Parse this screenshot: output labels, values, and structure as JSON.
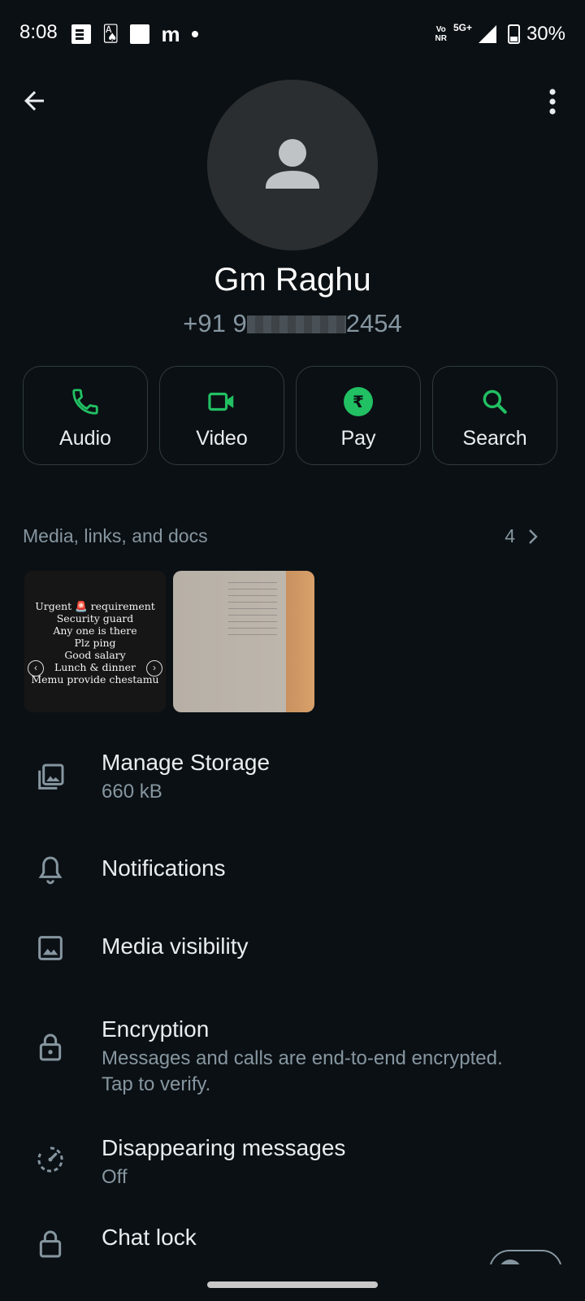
{
  "status_bar": {
    "time": "8:08",
    "network": "5G+",
    "volte_line1": "Vo",
    "volte_line2": "NR",
    "battery": "30%",
    "app_icons": [
      "news-icon",
      "cards-icon",
      "square-icon",
      "m-app-icon",
      "dot-icon"
    ]
  },
  "header": {
    "back_icon": "arrow-left-icon",
    "menu_icon": "more-vert-icon"
  },
  "contact": {
    "name": "Gm Raghu",
    "phone_prefix": "+91 9",
    "phone_suffix": "2454"
  },
  "actions": [
    {
      "label": "Audio",
      "icon": "phone-icon"
    },
    {
      "label": "Video",
      "icon": "video-icon"
    },
    {
      "label": "Pay",
      "icon": "rupee-icon"
    },
    {
      "label": "Search",
      "icon": "search-icon"
    }
  ],
  "media": {
    "title": "Media, links, and docs",
    "count": "4",
    "thumb1_lines": [
      "Urgent 🚨 requirement",
      "Security guard",
      "Any one is there",
      "Plz ping",
      "Good salary",
      "Lunch & dinner",
      "Memu provide chestamu"
    ]
  },
  "items": {
    "storage_title": "Manage Storage",
    "storage_sub": "660 kB",
    "notifications_title": "Notifications",
    "media_visibility_title": "Media visibility",
    "encryption_title": "Encryption",
    "encryption_sub": "Messages and calls are end-to-end encrypted. Tap to verify.",
    "disappearing_title": "Disappearing messages",
    "disappearing_sub": "Off",
    "chatlock_title": "Chat lock"
  },
  "colors": {
    "background": "#0b1014",
    "accent_green": "#21c063",
    "secondary_text": "#8696a0"
  }
}
